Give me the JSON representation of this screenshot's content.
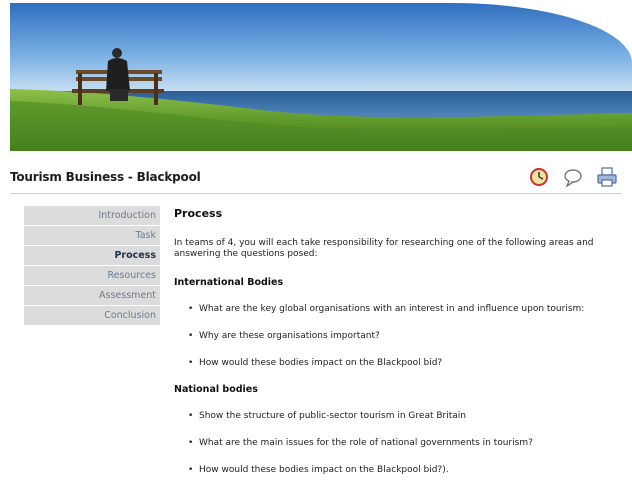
{
  "page": {
    "title": "Tourism Business - Blackpool"
  },
  "toolbar": {
    "icons": [
      "clock-icon",
      "comment-icon",
      "printer-icon"
    ]
  },
  "sidebar": {
    "items": [
      {
        "label": "Introduction",
        "active": false
      },
      {
        "label": "Task",
        "active": false
      },
      {
        "label": "Process",
        "active": true
      },
      {
        "label": "Resources",
        "active": false
      },
      {
        "label": "Assessment",
        "active": false
      },
      {
        "label": "Conclusion",
        "active": false
      }
    ]
  },
  "main": {
    "heading": "Process",
    "intro": "In teams of 4, you will each take responsibility for researching one of the following areas and answering the questions posed:",
    "sections": [
      {
        "heading": "International Bodies",
        "bullets": [
          "What are the key global organisations with an interest in and influence upon tourism:",
          "Why are these organisations important?",
          "How would these bodies impact on the Blackpool bid?"
        ]
      },
      {
        "heading": "National bodies",
        "bullets": [
          "Show the structure of public-sector tourism in Great Britain",
          "What are the main issues for the role of national governments in tourism?",
          "How would these bodies impact on the Blackpool bid?)."
        ]
      }
    ]
  },
  "colors": {
    "nav_bg": "#dcdcdc",
    "nav_text": "#6b7b93",
    "nav_active": "#22324d",
    "sky": "#4f8fd2",
    "sea": "#3f78b6",
    "grass": "#5f9a2c"
  }
}
